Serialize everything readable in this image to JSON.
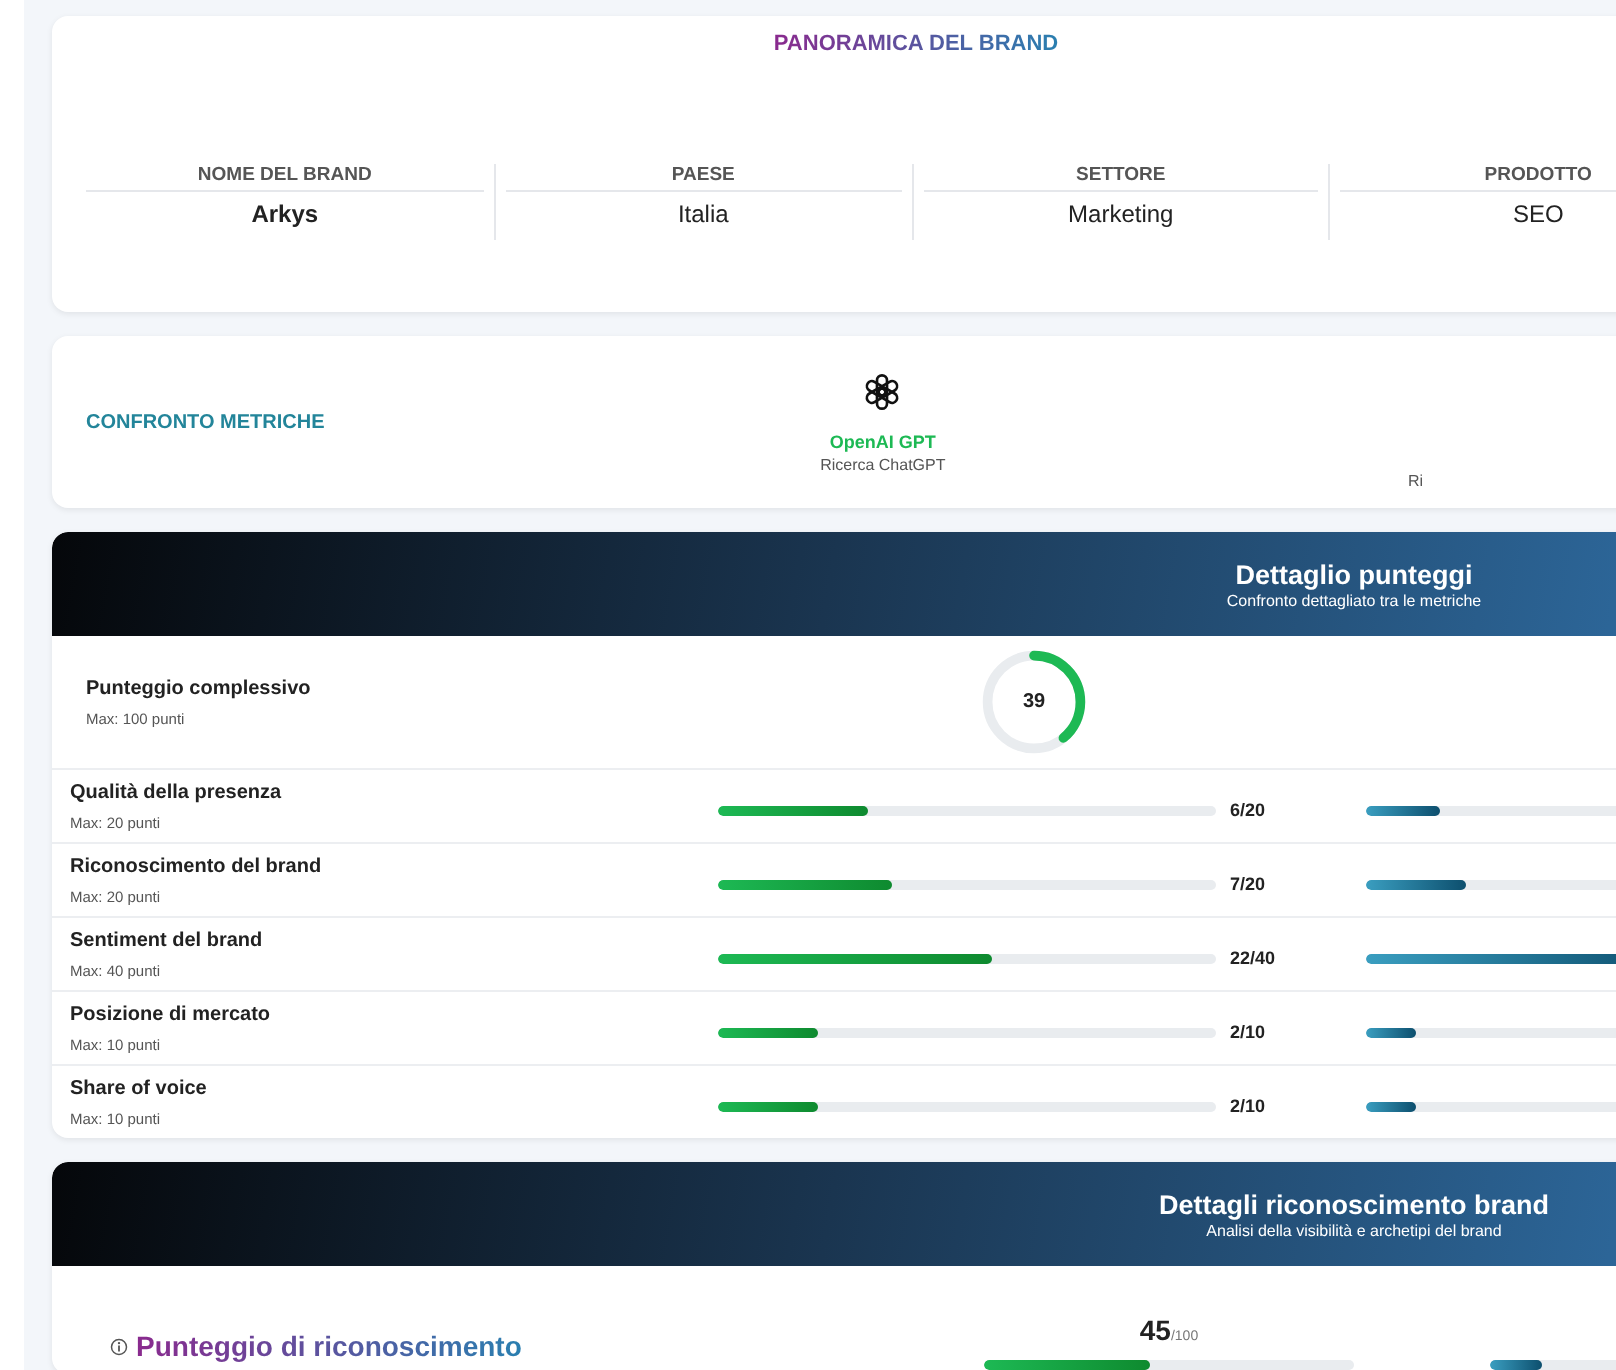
{
  "overview": {
    "title": "PANORAMICA DEL BRAND",
    "fields": [
      {
        "label": "NOME DEL BRAND",
        "value": "Arkys",
        "kind": "strong"
      },
      {
        "label": "PAESE",
        "value": "Italia",
        "kind": "plain"
      },
      {
        "label": "SETTORE",
        "value": "Marketing",
        "kind": "plain"
      },
      {
        "label": "PRODOTTO",
        "value": "SEO",
        "kind": "plain"
      }
    ]
  },
  "comparison": {
    "title": "CONFRONTO METRICHE",
    "models": [
      {
        "name": "OpenAI GPT",
        "subtitle": "Ricerca ChatGPT"
      },
      {
        "subtitle": "Ri"
      }
    ]
  },
  "score_detail": {
    "title": "Dettaglio punteggi",
    "subtitle": "Confronto dettagliato tra le metriche",
    "overall": {
      "label": "Punteggio complessivo",
      "max": "Max: 100 punti",
      "value": "39",
      "level": 0.39
    },
    "rows": [
      {
        "label": "Qualità della presenza",
        "max": "Max: 20 punti",
        "scores": [
          {
            "level": 0.3,
            "reading": "6/20"
          },
          {
            "level": 0.15
          }
        ]
      },
      {
        "label": "Riconoscimento del brand",
        "max": "Max: 20 punti",
        "scores": [
          {
            "level": 0.35,
            "reading": "7/20"
          },
          {
            "level": 0.2
          }
        ]
      },
      {
        "label": "Sentiment del brand",
        "max": "Max: 40 punti",
        "scores": [
          {
            "level": 0.55,
            "reading": "22/40"
          },
          {
            "level": 0.6
          }
        ]
      },
      {
        "label": "Posizione di mercato",
        "max": "Max: 10 punti",
        "scores": [
          {
            "level": 0.2,
            "reading": "2/10"
          },
          {
            "level": 0.1
          }
        ]
      },
      {
        "label": "Share of voice",
        "max": "Max: 10 punti",
        "scores": [
          {
            "level": 0.2,
            "reading": "2/10"
          },
          {
            "level": 0.1
          }
        ]
      }
    ]
  },
  "recognition": {
    "title": "Dettagli riconoscimento brand",
    "subtitle": "Analisi della visibilità e archetipi del brand",
    "score_label": "Punteggio di riconoscimento",
    "scores": [
      {
        "value": "45",
        "max": "/100",
        "level": 0.45
      },
      {
        "level": 0.14
      }
    ]
  }
}
